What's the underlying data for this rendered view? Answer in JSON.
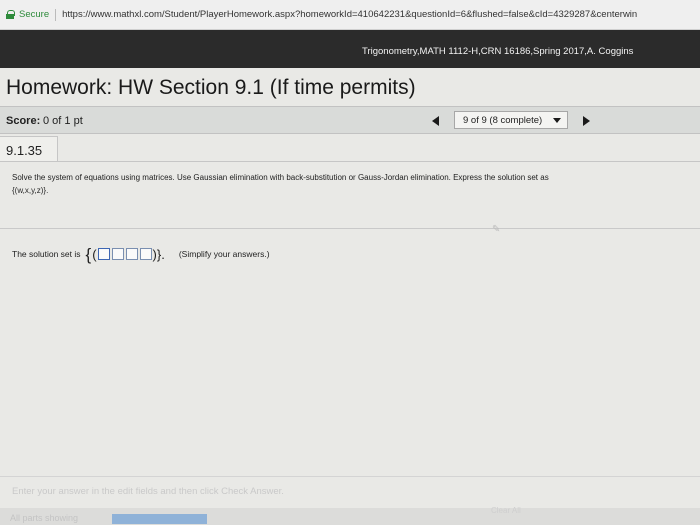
{
  "browser": {
    "secure_label": "Secure",
    "url": "https://www.mathxl.com/Student/PlayerHomework.aspx?homeworkId=410642231&questionId=6&flushed=false&cId=4329287&centerwin"
  },
  "course": {
    "label": "Trigonometry,MATH 1112-H,CRN 16186,Spring 2017,A. Coggins"
  },
  "homework": {
    "title": "Homework: HW Section 9.1 (If time permits)"
  },
  "score": {
    "label": "Score:",
    "value": "0 of 1 pt"
  },
  "navigator": {
    "selected": "9 of 9 (8 complete)"
  },
  "question": {
    "number": "9.1.35",
    "instructions": "Solve the system of equations using matrices. Use Gaussian elimination with back-substitution or Gauss-Jordan elimination. Express the solution set as",
    "set_notation": "{(w,x,y,z)}."
  },
  "answer": {
    "label": "The solution set is",
    "open_brace": "{",
    "open_paren": "(",
    "close": ")}.",
    "simplify": "(Simplify your answers.)"
  },
  "footer": {
    "hint": "Enter your answer in the edit fields and then click Check Answer.",
    "all_parts": "All parts showing",
    "progress": 1.0,
    "clear_all": "Clear All"
  },
  "colors": {
    "course_band": "#2b2b2b",
    "secure": "#2e8b3b",
    "progress": "#8fb2d8"
  }
}
